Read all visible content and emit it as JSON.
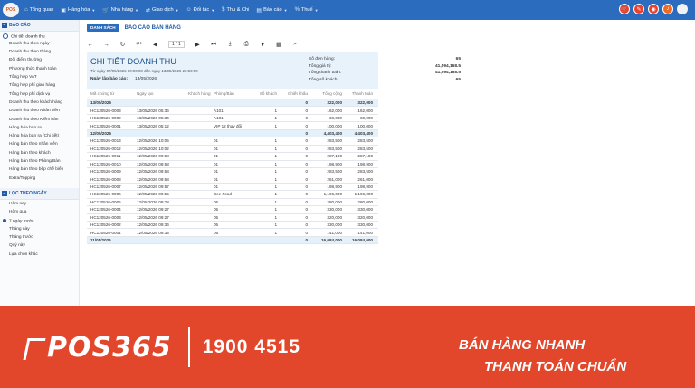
{
  "topbar": {
    "logo_text": "POS",
    "menu": [
      {
        "icon": "home-icon",
        "label": "Tổng quan",
        "caret": false
      },
      {
        "icon": "box-icon",
        "label": "Hàng hóa",
        "caret": true
      },
      {
        "icon": "cart-icon",
        "label": "Nhà hàng",
        "caret": true
      },
      {
        "icon": "swap-icon",
        "label": "Giao dịch",
        "caret": true
      },
      {
        "icon": "users-icon",
        "label": "Đối tác",
        "caret": true
      },
      {
        "icon": "money-icon",
        "label": "Thu & Chi",
        "caret": false
      },
      {
        "icon": "chart-icon",
        "label": "Báo cáo",
        "caret": true
      },
      {
        "icon": "tax-icon",
        "label": "Thuế",
        "caret": true
      }
    ],
    "right_icons": [
      "cart-icon",
      "edit-icon",
      "location-icon",
      "bell-icon",
      "user-avatar"
    ],
    "bell_badge": "99"
  },
  "sidebar": {
    "section1_title": "BÁO CÁO",
    "reports": [
      "Chi tiết doanh thu",
      "Doanh thu theo ngày",
      "Doanh thu theo tháng",
      "Đối điểm thưởng",
      "Phương thức thanh toán",
      "Tổng hợp VAT",
      "Tổng hợp phí giao hàng",
      "Tổng hợp phí dịch vụ",
      "Doanh thu theo khách hàng",
      "Doanh thu theo Nhân viên",
      "Doanh thu theo Kiểm bàn",
      "Hàng hóa bán ra",
      "Hàng hóa bán ra (Chi tiết)",
      "Hàng bán theo nhân viên",
      "Hàng bán theo khách",
      "Hàng bán theo Phòng/Bàn",
      "Hàng bán theo bếp chế biến",
      "Extra/Topping"
    ],
    "section2_title": "LỌC THEO NGÀY",
    "date_filters": [
      "Hôm nay",
      "Hôm qua",
      "7 ngày trước",
      "Tháng này",
      "Tháng trước",
      "Quý này",
      "Lựa chọn khác"
    ]
  },
  "tabs": {
    "button_label": "DANH SÁCH",
    "title": "BÁO CÁO BÁN HÀNG"
  },
  "toolbar": {
    "page_value": "1 / 1",
    "icons": [
      "arrow-left-icon",
      "arrow-right-icon",
      "refresh-icon",
      "first-page-icon",
      "prev-page-icon",
      "next-page-icon",
      "last-page-icon",
      "export-icon",
      "print-icon",
      "filter-icon",
      "layout-icon",
      "search-icon"
    ]
  },
  "report": {
    "title": "CHI TIẾT DOANH THU",
    "subtitle": "Từ ngày 07/05/2026 00:00:00 đến ngày 13/05/2026 23:59:59",
    "created_label": "Ngày lập báo cáo:",
    "created_date": "13/05/2026",
    "summary": [
      {
        "label": "Số đơn hàng:",
        "value": "65"
      },
      {
        "label": "Tổng giá trị:",
        "value": "41,594,168.5"
      },
      {
        "label": "Tổng thanh toán:",
        "value": "41,594,168.5"
      },
      {
        "label": "Tổng số khách:",
        "value": "65"
      }
    ],
    "columns": [
      "Mã chứng từ",
      "Ngày tạo",
      "Khách hàng",
      "Phòng/Bàn",
      "Số khách",
      "Chiết khấu",
      "Tổng cộng",
      "Thanh toán"
    ],
    "rows": [
      {
        "group": true,
        "cells": [
          "13/05/2026",
          "",
          "",
          "",
          "",
          "0",
          "322,000",
          "322,000"
        ]
      },
      {
        "group": false,
        "cells": [
          "HC130526-0003",
          "13/05/2026 05:36",
          "",
          "A101",
          "1",
          "0",
          "162,000",
          "162,000"
        ]
      },
      {
        "group": false,
        "cells": [
          "HC130526-0002",
          "13/05/2026 05:34",
          "",
          "A101",
          "1",
          "0",
          "60,000",
          "60,000"
        ]
      },
      {
        "group": false,
        "cells": [
          "HC130526-0001",
          "13/05/2026 05:12",
          "",
          "VIP 12 thay đổi",
          "1",
          "0",
          "100,000",
          "100,000"
        ]
      },
      {
        "group": true,
        "cells": [
          "12/05/2026",
          "",
          "",
          "",
          "",
          "0",
          "4,403,400",
          "4,403,400"
        ]
      },
      {
        "group": false,
        "cells": [
          "HC120526-0013",
          "12/05/2026 10:05",
          "",
          "01",
          "1",
          "0",
          "283,500",
          "283,500"
        ]
      },
      {
        "group": false,
        "cells": [
          "HC120526-0012",
          "12/05/2026 10:02",
          "",
          "01",
          "1",
          "0",
          "283,500",
          "283,500"
        ]
      },
      {
        "group": false,
        "cells": [
          "HC120526-0011",
          "12/05/2026 09:58",
          "",
          "01",
          "1",
          "0",
          "287,100",
          "287,100"
        ]
      },
      {
        "group": false,
        "cells": [
          "HC120526-0010",
          "12/05/2026 09:58",
          "",
          "01",
          "1",
          "0",
          "198,900",
          "198,900"
        ]
      },
      {
        "group": false,
        "cells": [
          "HC120526-0009",
          "12/05/2026 09:58",
          "",
          "01",
          "1",
          "0",
          "283,500",
          "283,500"
        ]
      },
      {
        "group": false,
        "cells": [
          "HC120526-0008",
          "12/05/2026 09:58",
          "",
          "01",
          "1",
          "0",
          "261,000",
          "261,000"
        ]
      },
      {
        "group": false,
        "cells": [
          "HC120526-0007",
          "12/05/2026 09:57",
          "",
          "01",
          "1",
          "0",
          "198,900",
          "198,900"
        ]
      },
      {
        "group": false,
        "cells": [
          "HC120526-0006",
          "12/05/2026 09:55",
          "",
          "Bee Food",
          "1",
          "0",
          "1,196,000",
          "1,196,000"
        ]
      },
      {
        "group": false,
        "cells": [
          "HC120526-0005",
          "12/05/2026 09:28",
          "",
          "05",
          "1",
          "0",
          "280,000",
          "280,000"
        ]
      },
      {
        "group": false,
        "cells": [
          "HC120526-0004",
          "12/05/2026 09:27",
          "",
          "05",
          "1",
          "0",
          "330,000",
          "330,000"
        ]
      },
      {
        "group": false,
        "cells": [
          "HC120526-0003",
          "12/05/2026 09:27",
          "",
          "05",
          "1",
          "0",
          "320,000",
          "320,000"
        ]
      },
      {
        "group": false,
        "cells": [
          "HC120526-0002",
          "12/05/2026 09:36",
          "",
          "05",
          "1",
          "0",
          "330,000",
          "330,000"
        ]
      },
      {
        "group": false,
        "cells": [
          "HC120526-0001",
          "12/05/2026 09:35",
          "",
          "05",
          "1",
          "0",
          "141,000",
          "141,000"
        ]
      },
      {
        "group": true,
        "cells": [
          "11/05/2026",
          "",
          "",
          "",
          "",
          "0",
          "16,084,000",
          "16,084,000"
        ]
      }
    ]
  },
  "banner": {
    "brand": "POS365",
    "hotline": "1900 4515",
    "slogan_line1": "BÁN HÀNG NHANH",
    "slogan_line2": "THANH TOÁN CHUẨN",
    "color": "#e2462b"
  }
}
